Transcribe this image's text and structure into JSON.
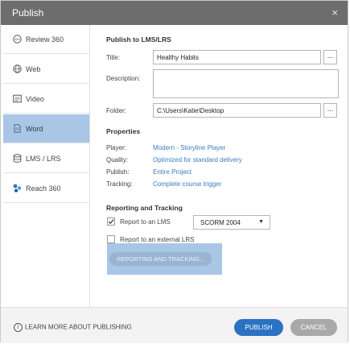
{
  "window": {
    "title": "Publish",
    "close_glyph": "×"
  },
  "sidebar": {
    "items": [
      {
        "label": "Review 360",
        "icon": "review-360-icon"
      },
      {
        "label": "Web",
        "icon": "web-globe-icon"
      },
      {
        "label": "Video",
        "icon": "video-icon"
      },
      {
        "label": "Word",
        "icon": "word-document-icon",
        "active": true
      },
      {
        "label": "LMS / LRS",
        "icon": "lms-database-icon"
      },
      {
        "label": "Reach 360",
        "icon": "reach-360-icon"
      }
    ]
  },
  "main": {
    "heading": "Publish to LMS/LRS",
    "title_label": "Title:",
    "title_value": "Healthy Habits",
    "description_label": "Description:",
    "description_value": "",
    "folder_label": "Folder:",
    "folder_value": "C:\\Users\\Katie\\Desktop",
    "browse_label": "...",
    "properties": {
      "heading": "Properties",
      "rows": [
        {
          "label": "Player:",
          "value": "Modern - Storyline Player"
        },
        {
          "label": "Quality:",
          "value": "Optimized for standard delivery"
        },
        {
          "label": "Publish:",
          "value": "Entire Project"
        },
        {
          "label": "Tracking:",
          "value": "Complete course trigger"
        }
      ]
    },
    "reporting": {
      "heading": "Reporting and Tracking",
      "report_lms_label": "Report to an LMS",
      "report_lms_checked": true,
      "lms_standard": "SCORM 2004",
      "report_external_label": "Report to an external LRS",
      "report_external_checked": false,
      "button_label": "REPORTING AND TRACKING..."
    }
  },
  "footer": {
    "learn_more": "LEARN MORE ABOUT PUBLISHING",
    "publish_label": "PUBLISH",
    "cancel_label": "CANCEL"
  },
  "colors": {
    "accent": "#2b72c2",
    "link": "#3a7cc0",
    "active_highlight": "#a9c6e6",
    "titlebar": "#6d6d6d"
  }
}
